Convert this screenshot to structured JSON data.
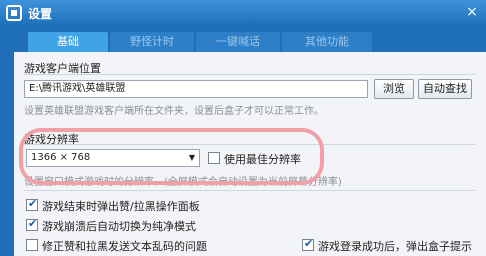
{
  "window": {
    "title": "设置",
    "close": "×"
  },
  "tabs": [
    "基础",
    "野怪计时",
    "一键喊话",
    "其他功能"
  ],
  "game_path": {
    "label": "游戏客户端位置",
    "value": "E:\\腾讯游戏\\英雄联盟",
    "browse_label": "浏览",
    "auto_find_label": "自动查找",
    "hint": "设置英雄联盟游戏客户端所在文件夹，设置后盒子才可以正常工作。"
  },
  "resolution": {
    "label": "游戏分辨率",
    "selected": "1366 × 768",
    "best_label": "使用最佳分辨率",
    "best_checked": false,
    "hint": "设置窗口模式游戏时的分辨率。(全屏模式会自动设置为当前屏幕分辨率)"
  },
  "options": [
    {
      "label": "游戏结束时弹出赞/拉黑操作面板",
      "checked": true
    },
    {
      "label": "游戏崩溃后自动切换为纯净模式",
      "checked": true
    },
    {
      "label": "修正赞和拉黑发送文本乱码的问题",
      "checked": false
    },
    {
      "label": "游戏登录成功后，弹出盒子提示",
      "checked": true
    }
  ]
}
